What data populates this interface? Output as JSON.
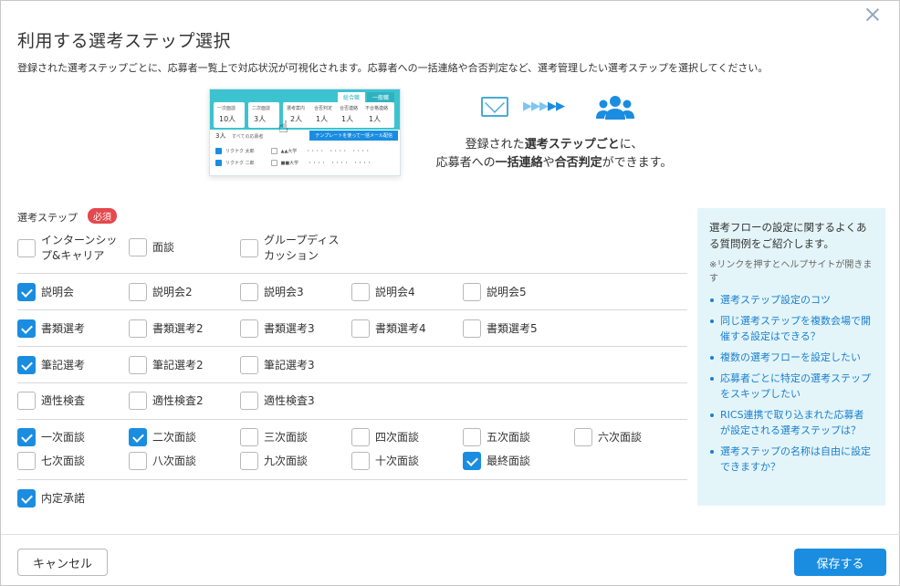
{
  "dialog": {
    "title": "利用する選考ステップ選択",
    "description": "登録された選考ステップごとに、応募者一覧上で対応状況が可視化されます。応募者への一括連絡や合否判定など、選考管理したい選考ステップを選択してください。"
  },
  "illustration": {
    "tab_summary": "総合職",
    "tab_general": "一般職",
    "cells": [
      {
        "label": "一次面談",
        "value": "10人"
      },
      {
        "label": "二次面談",
        "value": "3人"
      },
      {
        "label": "選考案内",
        "value": "2人"
      },
      {
        "label": "合否判定",
        "value": "1人"
      },
      {
        "label": "合否連絡",
        "value": "1人"
      },
      {
        "label": "不合格連絡",
        "value": "1人"
      }
    ],
    "count_text": "3人",
    "count_sub": "すべての応募者",
    "template_button": "テンプレートを使って一括メール配信",
    "rows": [
      {
        "name": "リクナク 太郎",
        "school": "▲▲大学",
        "dots": "・・・・　・・・・　・・・・"
      },
      {
        "name": "リクナク 二郎",
        "school": "■■大学",
        "dots": "・・・・　・・・・　・・・・"
      }
    ]
  },
  "caption": {
    "line1_pre": "登録された",
    "line1_bold": "選考ステップごと",
    "line1_post": "に、",
    "line2_pre": "応募者への",
    "line2_bold1": "一括連絡",
    "line2_mid": "や",
    "line2_bold2": "合否判定",
    "line2_post": "ができます。"
  },
  "steps": {
    "label": "選考ステップ",
    "required_badge": "必須",
    "items": [
      {
        "label": "インターンシップ&キャリア",
        "label_line1": "インターンシッ",
        "label_line2": "プ&キャリア",
        "checked": false
      },
      {
        "label": "面談",
        "checked": false
      },
      {
        "label": "グループディスカッション",
        "label_line1": "グループディス",
        "label_line2": "カッション",
        "checked": false
      },
      {
        "label": "説明会",
        "checked": true
      },
      {
        "label": "説明会2",
        "checked": false
      },
      {
        "label": "説明会3",
        "checked": false
      },
      {
        "label": "説明会4",
        "checked": false
      },
      {
        "label": "説明会5",
        "checked": false
      },
      {
        "label": "書類選考",
        "checked": true
      },
      {
        "label": "書類選考2",
        "checked": false
      },
      {
        "label": "書類選考3",
        "checked": false
      },
      {
        "label": "書類選考4",
        "checked": false
      },
      {
        "label": "書類選考5",
        "checked": false
      },
      {
        "label": "筆記選考",
        "checked": true
      },
      {
        "label": "筆記選考2",
        "checked": false
      },
      {
        "label": "筆記選考3",
        "checked": false
      },
      {
        "label": "適性検査",
        "checked": false
      },
      {
        "label": "適性検査2",
        "checked": false
      },
      {
        "label": "適性検査3",
        "checked": false
      },
      {
        "label": "一次面談",
        "checked": true
      },
      {
        "label": "二次面談",
        "checked": true
      },
      {
        "label": "三次面談",
        "checked": false
      },
      {
        "label": "四次面談",
        "checked": false
      },
      {
        "label": "五次面談",
        "checked": false
      },
      {
        "label": "六次面談",
        "checked": false
      },
      {
        "label": "七次面談",
        "checked": false
      },
      {
        "label": "八次面談",
        "checked": false
      },
      {
        "label": "九次面談",
        "checked": false
      },
      {
        "label": "十次面談",
        "checked": false
      },
      {
        "label": "最終面談",
        "checked": true
      },
      {
        "label": "内定承諾",
        "checked": true
      }
    ]
  },
  "faq": {
    "title": "選考フローの設定に関するよくある質問例をご紹介します。",
    "note": "※リンクを押すとヘルプサイトが開きます",
    "links": [
      "選考ステップ設定のコツ",
      "同じ選考ステップを複数会場で開催する設定はできる？",
      "複数の選考フローを設定したい",
      "応募者ごとに特定の選考ステップをスキップしたい",
      "RICS連携で取り込まれた応募者が設定される選考ステップは？",
      "選考ステップの名称は自由に設定できますか？"
    ]
  },
  "footer": {
    "cancel_label": "キャンセル",
    "save_label": "保存する"
  },
  "colors": {
    "accent": "#1a8de0",
    "required": "#e5484d",
    "side_panel": "#e4f5f9"
  }
}
